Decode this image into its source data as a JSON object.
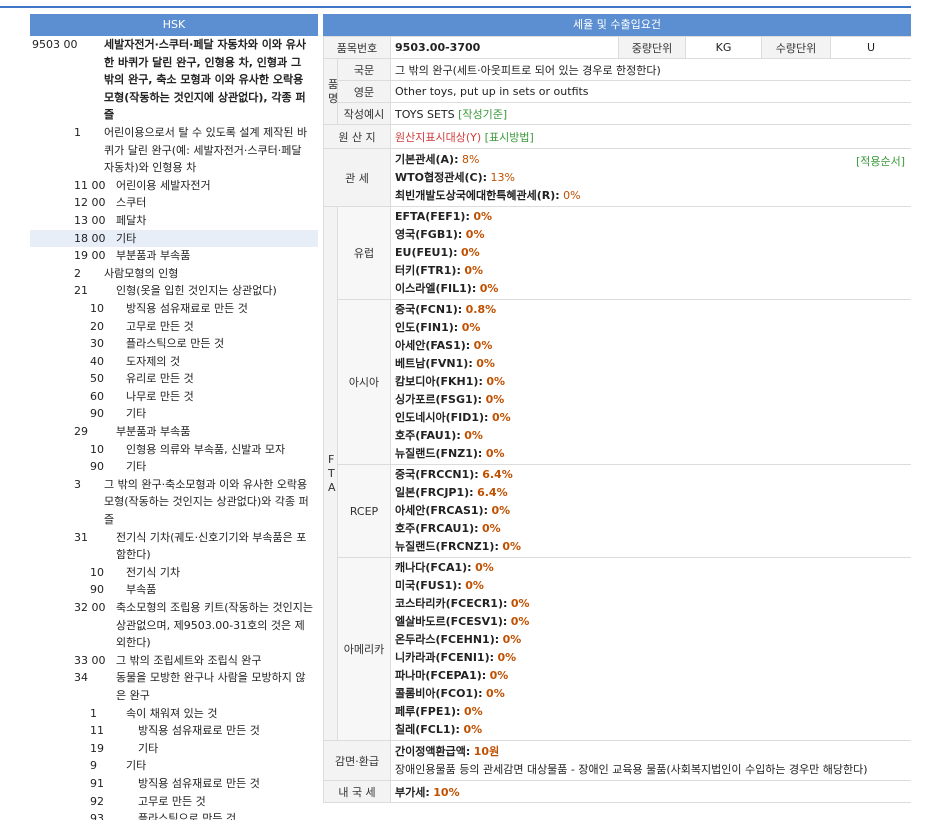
{
  "left_panel": {
    "header": "HSK",
    "rows": [
      {
        "code": "9503 00",
        "level": "h4",
        "desc": "세발자전거·스쿠터·페달 자동차와 이와 유사한 바퀴가 달린 완구, 인형용 차, 인형과 그 밖의 완구, 축소 모형과 이와 유사한 오락용 모형(작동하는 것인지에 상관없다), 각종 퍼즐",
        "bold": true
      },
      {
        "code": "1",
        "level": "s1",
        "desc": "어린이용으로서 탈 수 있도록 설계 제작된 바퀴가 달린 완구(예: 세발자전거·스쿠터·페달 자동차)와 인형용 차"
      },
      {
        "code": "11 00",
        "level": "s2",
        "desc": "어린이용 세발자전거"
      },
      {
        "code": "12 00",
        "level": "s2",
        "desc": "스쿠터"
      },
      {
        "code": "13 00",
        "level": "s2",
        "desc": "페달차"
      },
      {
        "code": "18 00",
        "level": "s2",
        "desc": "기타",
        "selected": true
      },
      {
        "code": "19 00",
        "level": "s2",
        "desc": "부분품과 부속품"
      },
      {
        "code": "2",
        "level": "s1",
        "desc": "사람모형의 인형"
      },
      {
        "code": "21",
        "level": "s2",
        "desc": "인형(옷을 입힌 것인지는 상관없다)"
      },
      {
        "code": "10",
        "level": "d2",
        "desc": "방직용 섬유재료로 만든 것"
      },
      {
        "code": "20",
        "level": "d2",
        "desc": "고무로 만든 것"
      },
      {
        "code": "30",
        "level": "d2",
        "desc": "플라스틱으로 만든 것"
      },
      {
        "code": "40",
        "level": "d2",
        "desc": "도자제의 것"
      },
      {
        "code": "50",
        "level": "d2",
        "desc": "유리로 만든 것"
      },
      {
        "code": "60",
        "level": "d2",
        "desc": "나무로 만든 것"
      },
      {
        "code": "90",
        "level": "d2",
        "desc": "기타"
      },
      {
        "code": "29",
        "level": "s2",
        "desc": "부분품과 부속품"
      },
      {
        "code": "10",
        "level": "d2",
        "desc": "인형용 의류와 부속품, 신발과 모자"
      },
      {
        "code": "90",
        "level": "d2",
        "desc": "기타"
      },
      {
        "code": "3",
        "level": "s1",
        "desc": "그 밖의 완구·축소모형과 이와 유사한 오락용 모형(작동하는 것인지는 상관없다)와 각종 퍼즐"
      },
      {
        "code": "31",
        "level": "s2",
        "desc": "전기식 기차(궤도·신호기기와 부속품은 포함한다)"
      },
      {
        "code": "10",
        "level": "d2",
        "desc": "전기식 기차"
      },
      {
        "code": "90",
        "level": "d2",
        "desc": "부속품"
      },
      {
        "code": "32 00",
        "level": "s2",
        "desc": "축소모형의 조립용 키트(작동하는 것인지는 상관없으며, 제9503.00-31호의 것은 제외한다)"
      },
      {
        "code": "33 00",
        "level": "s2",
        "desc": "그 밖의 조립세트와 조립식 완구"
      },
      {
        "code": "34",
        "level": "s2",
        "desc": "동물을 모방한 완구나 사람을 모방하지 않은 완구"
      },
      {
        "code": "1",
        "level": "d1",
        "desc": "속이 채워져 있는 것"
      },
      {
        "code": "11",
        "level": "d3",
        "desc": "방직용 섬유재료로 만든 것"
      },
      {
        "code": "19",
        "level": "d3",
        "desc": "기타"
      },
      {
        "code": "9",
        "level": "d1",
        "desc": "기타"
      },
      {
        "code": "91",
        "level": "d3",
        "desc": "방직용 섬유재료로 만든 것"
      },
      {
        "code": "92",
        "level": "d3",
        "desc": "고무로 만든 것"
      },
      {
        "code": "93",
        "level": "d3",
        "desc": "플라스틱으로 만든 것"
      }
    ]
  },
  "right_panel": {
    "header": "세율 및 수출입요건",
    "item": {
      "code_label": "품목번호",
      "code": "9503.00-3700",
      "weight_label": "중량단위",
      "weight": "KG",
      "qty_label": "수량단위",
      "qty": "U"
    },
    "name": {
      "group_label": "품명",
      "kr_label": "국문",
      "kr": "그 밖의 완구(세트·아웃피트로 되어 있는 경우로 한정한다)",
      "en_label": "영문",
      "en": "Other toys, put up in sets or outfits",
      "example_label": "작성예시",
      "example": "TOYS SETS",
      "example_link": "[작성기준]"
    },
    "origin": {
      "label": "원 산 지",
      "text": "원산지표시대상(Y)",
      "link": "[표시방법]"
    },
    "tariff": {
      "label": "관 세",
      "order_link": "[적용순서]",
      "rows": [
        {
          "name": "기본관세(A):",
          "rate": "8%"
        },
        {
          "name": "WTO협정관세(C):",
          "rate": "13%"
        },
        {
          "name": "최빈개발도상국에대한특혜관세(R):",
          "rate": "0%"
        }
      ]
    },
    "fta": {
      "label": "FTA",
      "groups": [
        {
          "region": "유럽",
          "rows": [
            {
              "name": "EFTA(FEF1):",
              "rate": "0%"
            },
            {
              "name": "영국(FGB1):",
              "rate": "0%"
            },
            {
              "name": "EU(FEU1):",
              "rate": "0%"
            },
            {
              "name": "터키(FTR1):",
              "rate": "0%"
            },
            {
              "name": "이스라엘(FIL1):",
              "rate": "0%"
            }
          ]
        },
        {
          "region": "아시아",
          "rows": [
            {
              "name": "중국(FCN1):",
              "rate": "0.8%"
            },
            {
              "name": "인도(FIN1):",
              "rate": "0%"
            },
            {
              "name": "아세안(FAS1):",
              "rate": "0%"
            },
            {
              "name": "베트남(FVN1):",
              "rate": "0%"
            },
            {
              "name": "캄보디아(FKH1):",
              "rate": "0%"
            },
            {
              "name": "싱가포르(FSG1):",
              "rate": "0%"
            },
            {
              "name": "인도네시아(FID1):",
              "rate": "0%"
            },
            {
              "name": "호주(FAU1):",
              "rate": "0%"
            },
            {
              "name": "뉴질랜드(FNZ1):",
              "rate": "0%"
            }
          ]
        },
        {
          "region": "RCEP",
          "rows": [
            {
              "name": "중국(FRCCN1):",
              "rate": "6.4%"
            },
            {
              "name": "일본(FRCJP1):",
              "rate": "6.4%"
            },
            {
              "name": "아세안(FRCAS1):",
              "rate": "0%"
            },
            {
              "name": "호주(FRCAU1):",
              "rate": "0%"
            },
            {
              "name": "뉴질랜드(FRCNZ1):",
              "rate": "0%"
            }
          ]
        },
        {
          "region": "아메리카",
          "rows": [
            {
              "name": "캐나다(FCA1):",
              "rate": "0%"
            },
            {
              "name": "미국(FUS1):",
              "rate": "0%"
            },
            {
              "name": "코스타리카(FCECR1):",
              "rate": "0%"
            },
            {
              "name": "엘살바도르(FCESV1):",
              "rate": "0%"
            },
            {
              "name": "온두라스(FCEHN1):",
              "rate": "0%"
            },
            {
              "name": "니카라과(FCENI1):",
              "rate": "0%"
            },
            {
              "name": "파나마(FCEPA1):",
              "rate": "0%"
            },
            {
              "name": "콜롬비아(FCO1):",
              "rate": "0%"
            },
            {
              "name": "페루(FPE1):",
              "rate": "0%"
            },
            {
              "name": "칠레(FCL1):",
              "rate": "0%"
            }
          ]
        }
      ]
    },
    "refund": {
      "label": "감면·환급",
      "line1_name": "간이정액환급액:",
      "line1_value": "10원",
      "line2": "장애인용물품 등의 관세감면 대상물품 - 장애인 교육용 물품(사회복지법인이 수입하는 경우만 해당한다)"
    },
    "domestic": {
      "label": "내 국 세",
      "name": "부가세:",
      "rate": "10%"
    }
  }
}
